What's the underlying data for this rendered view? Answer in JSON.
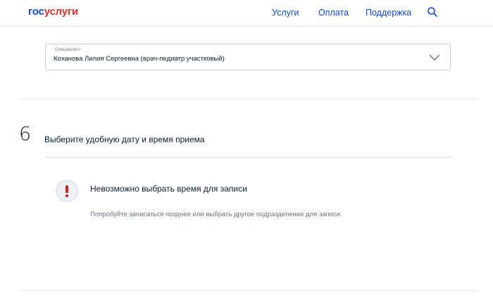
{
  "header": {
    "logo": {
      "part1": "гос",
      "part2": "услуги"
    },
    "nav": {
      "uslugi": "Услуги",
      "oplata": "Оплата",
      "podderzhka": "Поддержка"
    }
  },
  "specialist": {
    "label": "Специалист",
    "value": "Коханова Лилия Сергеевна (врач-педиатр участковый)"
  },
  "step": {
    "number": "6",
    "title": "Выберите удобную дату и время приема"
  },
  "alert": {
    "title": "Невозможно выбрать время для записи",
    "text": "Попробуйте записаться позднее или выбрать другое подразделение для записи."
  },
  "colors": {
    "brand_blue": "#0d4cd3",
    "brand_red": "#e4312c",
    "alert_red": "#d21c1c"
  },
  "icons": [
    "search-icon",
    "chevron-down-icon",
    "exclamation-icon"
  ]
}
